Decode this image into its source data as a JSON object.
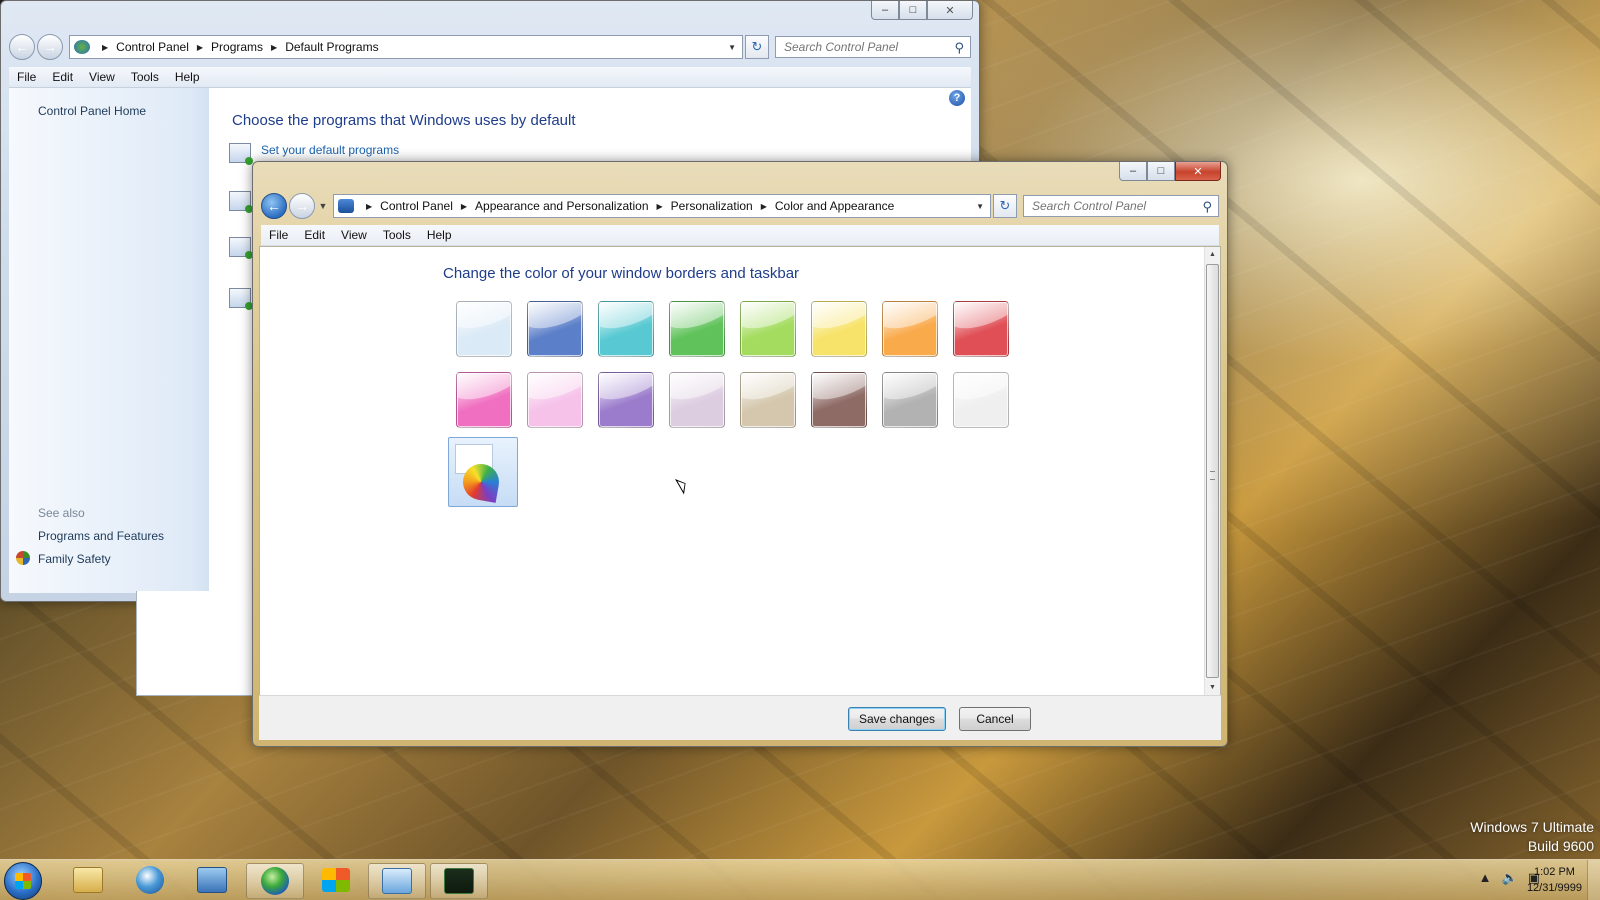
{
  "back_window": {
    "breadcrumb": [
      "Control Panel",
      "Programs",
      "Default Programs"
    ],
    "search_placeholder": "Search Control Panel",
    "menu": [
      "File",
      "Edit",
      "View",
      "Tools",
      "Help"
    ],
    "sidebar": {
      "home": "Control Panel Home",
      "see_also": "See also",
      "links": [
        "Programs and Features",
        "Family Safety"
      ]
    },
    "heading": "Choose the programs that Windows uses by default",
    "link_set_default": "Set your default programs"
  },
  "front_window": {
    "breadcrumb": [
      "Control Panel",
      "Appearance and Personalization",
      "Personalization",
      "Color and Appearance"
    ],
    "search_placeholder": "Search Control Panel",
    "menu": [
      "File",
      "Edit",
      "View",
      "Tools",
      "Help"
    ],
    "heading": "Change the color of your window borders and taskbar",
    "swatches_row1": [
      {
        "name": "sky",
        "color": "#dbeaf7"
      },
      {
        "name": "twilight",
        "color": "#5b7fc9"
      },
      {
        "name": "sea",
        "color": "#58c9d2"
      },
      {
        "name": "leaf",
        "color": "#5fc25a"
      },
      {
        "name": "lime",
        "color": "#a3dc5e"
      },
      {
        "name": "lemon",
        "color": "#f7e36a"
      },
      {
        "name": "pumpkin",
        "color": "#f9aa4b"
      },
      {
        "name": "ruby",
        "color": "#e04f56"
      }
    ],
    "swatches_row2": [
      {
        "name": "fuchsia",
        "color": "#f06fc0"
      },
      {
        "name": "blush",
        "color": "#f6c2ea"
      },
      {
        "name": "violet",
        "color": "#9b7ccc"
      },
      {
        "name": "lavender",
        "color": "#ddcde1"
      },
      {
        "name": "taupe",
        "color": "#d4c7ad"
      },
      {
        "name": "chocolate",
        "color": "#8f6b66"
      },
      {
        "name": "slate",
        "color": "#b2b2b2"
      },
      {
        "name": "frost",
        "color": "#efefef"
      }
    ],
    "save_label": "Save changes",
    "cancel_label": "Cancel"
  },
  "desktop": {
    "watermark_line1": "Windows 7 Ultimate",
    "watermark_line2": "Build 9600"
  },
  "taskbar": {
    "time": "1:02 PM",
    "date": "12/31/9999"
  }
}
